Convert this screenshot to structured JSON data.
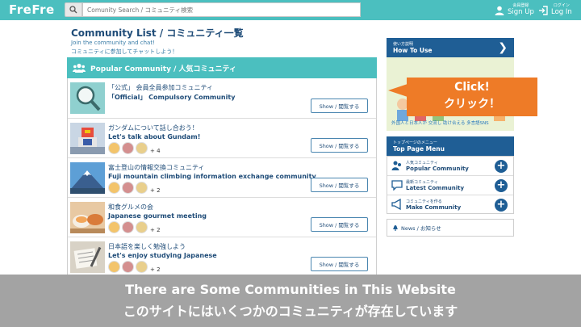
{
  "header": {
    "logo": "FreFre",
    "search_placeholder": "Comunity Search / コミュニティ検索",
    "signup_small": "会員登録",
    "signup_label": "Sign Up",
    "login_small": "ログイン",
    "login_label": "Log In",
    "bar_color": "#4bbfbf"
  },
  "main": {
    "title": "Community List / コミュニティ一覧",
    "intro_en": "Join the community and chat!",
    "intro_ja": "コミュニティに参加してチャットしよう！",
    "section_title": "Popular Community / 人気コミュニティ",
    "show_label": "Show / 閲覧する",
    "communities": [
      {
        "title": "「公式」 会員全員参加コミュニティ",
        "subtitle": "「Official」 Compulsory Community",
        "more": "",
        "thumb": "magnifier"
      },
      {
        "title": "ガンダムについて話し合おう！",
        "subtitle": "Let's talk about Gundam!",
        "more": "+ 4",
        "thumb": "robot"
      },
      {
        "title": "富士登山の情報交換コミュニティ",
        "subtitle": "Fuji mountain climbing information exchange community",
        "more": "+ 2",
        "thumb": "mountain"
      },
      {
        "title": "和食グルメの会",
        "subtitle": "Japanese gourmet meeting",
        "more": "+ 2",
        "thumb": "food"
      },
      {
        "title": "日本語を楽しく勉強しよう",
        "subtitle": "Let's enjoy studying Japanese",
        "more": "+ 2",
        "thumb": "study"
      }
    ]
  },
  "sidebar": {
    "howto_small": "使い方説明",
    "howto_label": "How To Use",
    "howto_caption": "外国人と日本人が 交流し 助け合える 多言語SNS",
    "menu_small": "トップページのメニュー",
    "menu_label": "Top Page Menu",
    "menu_items": [
      {
        "small": "人気コミュニティ",
        "label": "Popular Community"
      },
      {
        "small": "最新コミュニティ",
        "label": "Latest Community"
      },
      {
        "small": "コミュニティを作る",
        "label": "Make Community"
      }
    ],
    "news_label": "News / お知らせ"
  },
  "callout": {
    "line1": "Click!",
    "line2": "クリック！",
    "color": "#ee7b27"
  },
  "caption": {
    "line1": "There are Some Communities in This Website",
    "line2": "このサイトにはいくつかのコミュニティが存在しています"
  }
}
